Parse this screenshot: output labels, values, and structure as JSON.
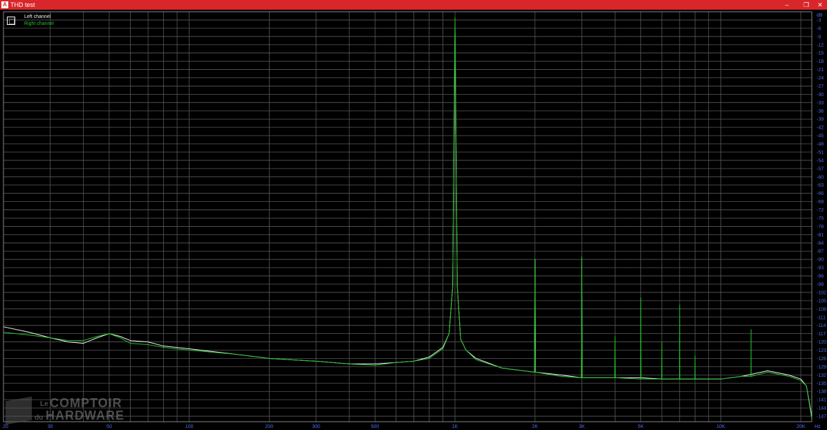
{
  "window": {
    "title": "THD test",
    "app_icon": "audio-tester-icon",
    "controls": [
      "minimize-icon",
      "restore-icon",
      "close-icon"
    ],
    "titlebar_color": "#d8262b"
  },
  "legend": {
    "entries": [
      {
        "label": "Left channel",
        "color": "#f4f4f4"
      },
      {
        "label": "Right channel",
        "color": "#22c326"
      }
    ]
  },
  "watermark": {
    "line1_small": "Le",
    "line1_big": "COMPTOIR",
    "line2_small": "du",
    "line2_big": "HARDWARE"
  },
  "chart_data": {
    "type": "line",
    "title": "",
    "xlabel": "Hz",
    "ylabel": "dB",
    "x_scale": "log",
    "xlim": [
      20,
      22000
    ],
    "ylim": [
      -149,
      0
    ],
    "grid": true,
    "legend_position": "top-left",
    "background": "#000000",
    "grid_color": "#5a5a5a",
    "tick_color": "#4b6ef5",
    "x_tick_labels": [
      {
        "value": 20,
        "label": "20"
      },
      {
        "value": 30,
        "label": "30"
      },
      {
        "value": 50,
        "label": "50"
      },
      {
        "value": 100,
        "label": "100"
      },
      {
        "value": 200,
        "label": "200"
      },
      {
        "value": 300,
        "label": "300"
      },
      {
        "value": 500,
        "label": "500"
      },
      {
        "value": 1000,
        "label": "1K"
      },
      {
        "value": 2000,
        "label": "2K"
      },
      {
        "value": 3000,
        "label": "3K"
      },
      {
        "value": 5000,
        "label": "5K"
      },
      {
        "value": 10000,
        "label": "10K"
      },
      {
        "value": 20000,
        "label": "20K"
      }
    ],
    "y_tick_labels": [
      "-3",
      "-6",
      "-9",
      "-12",
      "-15",
      "-18",
      "-21",
      "-24",
      "-27",
      "-30",
      "-33",
      "-36",
      "-39",
      "-42",
      "-45",
      "-48",
      "-51",
      "-54",
      "-57",
      "-60",
      "-63",
      "-66",
      "-69",
      "-72",
      "-75",
      "-78",
      "-81",
      "-84",
      "-87",
      "-90",
      "-93",
      "-96",
      "-99",
      "-102",
      "-105",
      "-108",
      "-111",
      "-114",
      "-117",
      "-120",
      "-123",
      "-126",
      "-129",
      "-132",
      "-135",
      "-138",
      "-141",
      "-144",
      "-147"
    ],
    "series": [
      {
        "name": "Left channel",
        "color": "#f4f4f4",
        "x": [
          20,
          25,
          30,
          35,
          40,
          45,
          50,
          55,
          60,
          70,
          80,
          100,
          150,
          200,
          300,
          400,
          500,
          600,
          700,
          800,
          900,
          950,
          980,
          1000,
          1020,
          1050,
          1100,
          1200,
          1500,
          1990,
          2000,
          2010,
          2500,
          2990,
          3000,
          3010,
          4000,
          5000,
          6000,
          7000,
          8000,
          10000,
          12000,
          15000,
          18000,
          20000,
          21000,
          22000
        ],
        "y": [
          -114.5,
          -116.5,
          -118.5,
          -120,
          -120.5,
          -118.5,
          -117,
          -118,
          -119.5,
          -120,
          -121.5,
          -122.5,
          -124.5,
          -126,
          -127,
          -128,
          -128,
          -127.5,
          -127,
          -125.5,
          -122,
          -117,
          -100,
          -6,
          -100,
          -119,
          -123,
          -126,
          -129.5,
          -131,
          -90,
          -131,
          -132,
          -133,
          -89.5,
          -133,
          -133,
          -133,
          -133.5,
          -133.5,
          -133.5,
          -133.5,
          -132.5,
          -130.5,
          -132,
          -133.5,
          -136,
          -147
        ]
      },
      {
        "name": "Right channel",
        "color": "#22c326",
        "x": [
          20,
          25,
          30,
          35,
          40,
          45,
          50,
          55,
          60,
          70,
          80,
          100,
          150,
          200,
          300,
          400,
          500,
          600,
          700,
          800,
          900,
          950,
          980,
          1000,
          1020,
          1050,
          1100,
          1200,
          1500,
          1990,
          2000,
          2010,
          2500,
          2990,
          3000,
          3010,
          3990,
          4000,
          4010,
          4990,
          5000,
          5010,
          5990,
          6000,
          6010,
          6990,
          7000,
          7010,
          7990,
          8000,
          8010,
          9000,
          10000,
          12000,
          12990,
          13000,
          13010,
          15000,
          18000,
          20000,
          21000,
          22000
        ],
        "y": [
          -116.5,
          -117.5,
          -118.5,
          -119.5,
          -119.5,
          -118,
          -117,
          -118.5,
          -120.5,
          -121,
          -122,
          -123,
          -124.5,
          -126,
          -127,
          -128,
          -128.5,
          -127.5,
          -127,
          -126,
          -122.5,
          -117,
          -100,
          -2,
          -100,
          -119,
          -123,
          -126.5,
          -129.5,
          -131,
          -90,
          -131,
          -132.5,
          -133,
          -89,
          -133,
          -133,
          -118,
          -133,
          -133.5,
          -104,
          -133.5,
          -133.5,
          -120,
          -133.5,
          -133.5,
          -106.5,
          -133.5,
          -133.5,
          -125,
          -133.5,
          -133.5,
          -133.5,
          -132.5,
          -132.5,
          -115.5,
          -132.5,
          -131,
          -132.5,
          -134,
          -136,
          -148
        ]
      }
    ]
  }
}
